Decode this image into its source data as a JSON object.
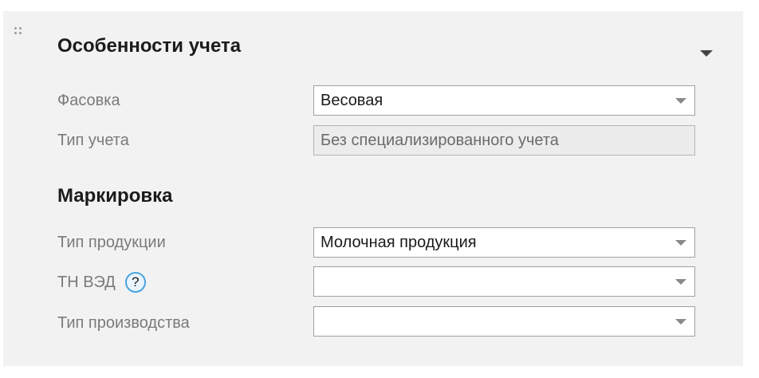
{
  "accounting": {
    "title": "Особенности учета",
    "packing": {
      "label": "Фасовка",
      "value": "Весовая"
    },
    "accounting_type": {
      "label": "Тип учета",
      "value": "Без специализированного учета"
    }
  },
  "marking": {
    "title": "Маркировка",
    "product_type": {
      "label": "Тип продукции",
      "value": "Молочная продукция"
    },
    "tn_ved": {
      "label": "ТН ВЭД",
      "help": "?",
      "value": ""
    },
    "production_type": {
      "label": "Тип производства",
      "value": ""
    }
  },
  "icons": {
    "drag": "drag-handle-icon",
    "collapse": "chevron-down-icon",
    "dropdown": "dropdown-arrow-icon",
    "help": "question-icon"
  },
  "colors": {
    "panel_background": "#f2f2f2",
    "help_icon_border": "#4aa3e0",
    "label_text": "#7a7a7a"
  }
}
